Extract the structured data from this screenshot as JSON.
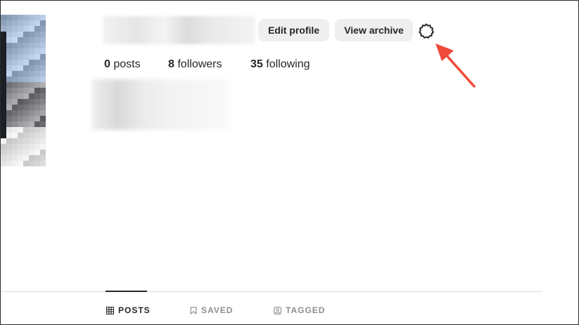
{
  "profile": {
    "edit_profile_label": "Edit profile",
    "view_archive_label": "View archive",
    "settings_icon": "gear-icon"
  },
  "stats": {
    "posts_count": "0",
    "posts_label": "posts",
    "followers_count": "8",
    "followers_label": "followers",
    "following_count": "35",
    "following_label": "following"
  },
  "tabs": [
    {
      "label": "POSTS",
      "icon": "grid-icon",
      "active": true
    },
    {
      "label": "SAVED",
      "icon": "bookmark-icon",
      "active": false
    },
    {
      "label": "TAGGED",
      "icon": "tagged-user-icon",
      "active": false
    }
  ],
  "colors": {
    "button_bg": "#efefef",
    "text": "#262626",
    "muted": "#8e8e8e",
    "annotation_arrow": "#f04a3a"
  }
}
